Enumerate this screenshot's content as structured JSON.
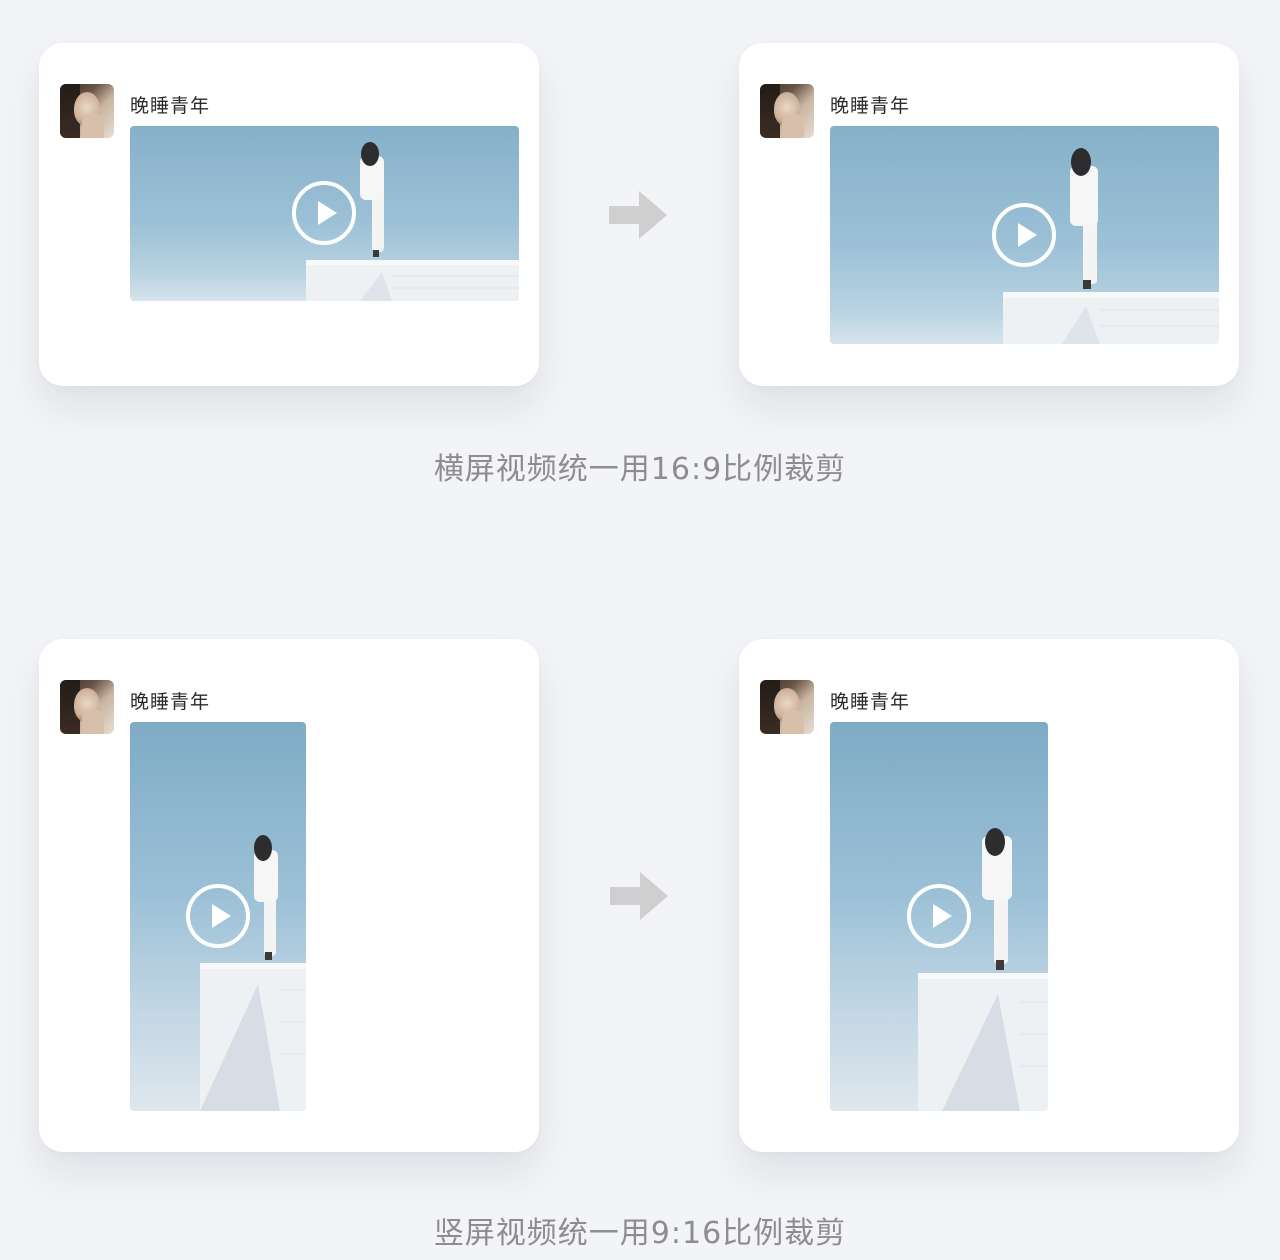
{
  "colors": {
    "background": "#f3f4f7",
    "card": "#ffffff",
    "caption": "#8d8d8d",
    "arrow": "#cfcfcf",
    "sky": "#9cc1d7"
  },
  "sections": [
    {
      "before": {
        "username": "晚睡青年",
        "orientation": "landscape"
      },
      "after": {
        "username": "晚睡青年",
        "orientation": "landscape",
        "aspect": "16:9"
      },
      "caption": "横屏视频统一用16:9比例裁剪"
    },
    {
      "before": {
        "username": "晚睡青年",
        "orientation": "portrait"
      },
      "after": {
        "username": "晚睡青年",
        "orientation": "portrait",
        "aspect": "9:16"
      },
      "caption": "竖屏视频统一用9:16比例裁剪"
    }
  ],
  "icons": {
    "play": "play-icon",
    "arrow": "arrow-right-icon",
    "avatar": "avatar"
  }
}
